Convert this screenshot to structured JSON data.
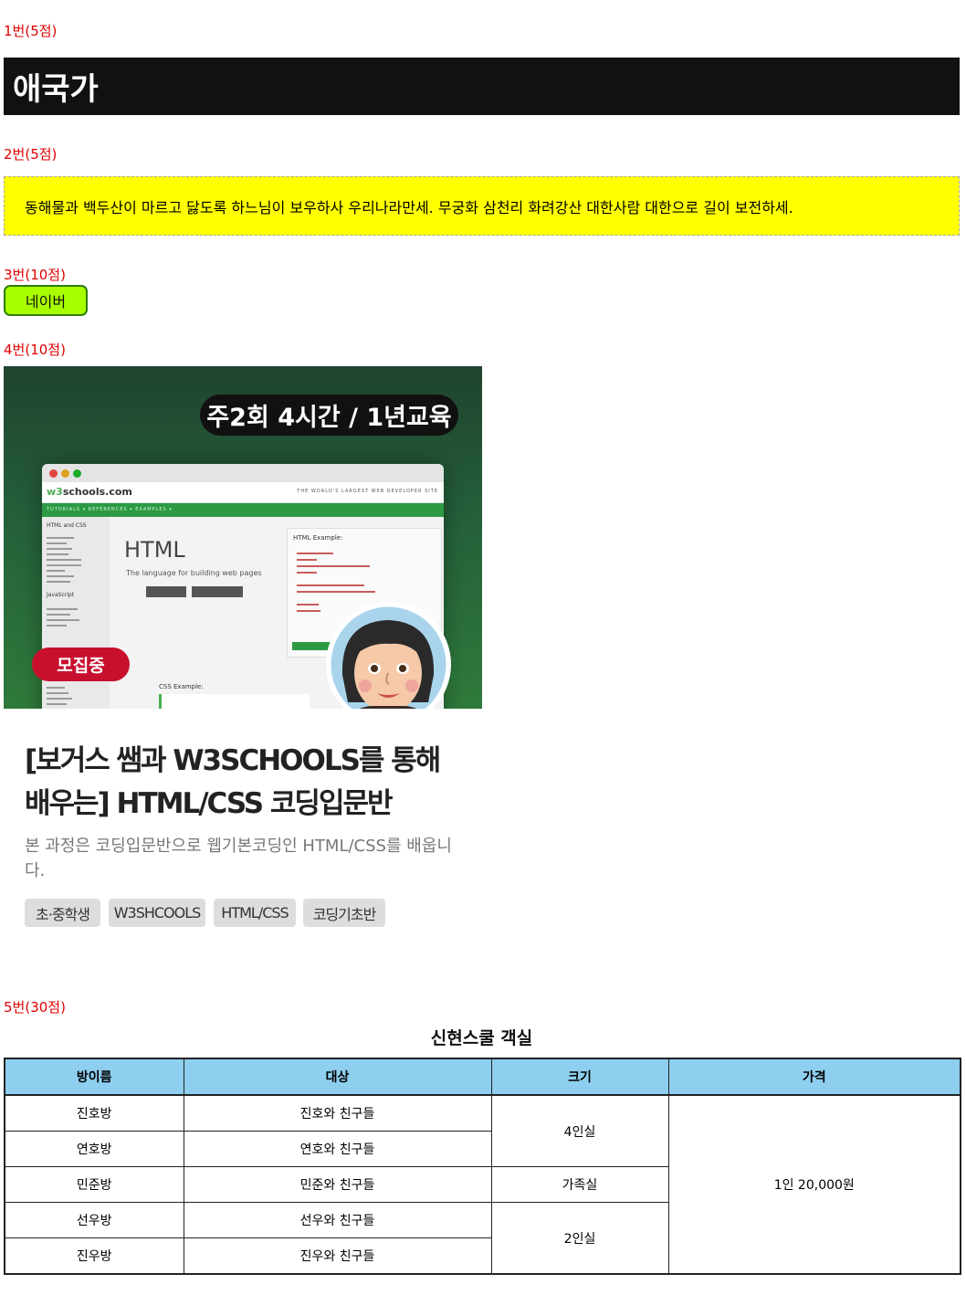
{
  "q1": {
    "label": "1번(5점)",
    "heading": "애국가"
  },
  "q2": {
    "label": "2번(5점)",
    "lyrics": "동해물과 백두산이 마르고 닳도록 하느님이 보우하사 우리나라만세. 무궁화 삼천리 화려강산 대한사람 대한으로 길이 보전하세."
  },
  "q3": {
    "label": "3번(10점)",
    "button": "네이버",
    "colors": {
      "fill": "#a8ff00",
      "border": "#2f7c06"
    }
  },
  "q4": {
    "label": "4번(10점)",
    "schedule_badge": "주2회 4시간 / 1년교육",
    "status_badge": "모집중",
    "screenshot": {
      "logo_prefix": "w3",
      "logo_rest": "schools.com",
      "tagline": "THE WORLD'S LARGEST WEB DEVELOPER SITE",
      "nav": "TUTORIALS ▾   REFERENCES ▾   EXAMPLES ▾",
      "side_heading_1": "HTML and CSS",
      "side_heading_2": "JavaScript",
      "main_title": "HTML",
      "main_sub": "The language for building web pages",
      "example_title": "HTML Example:",
      "css_example": "CSS Example:"
    },
    "title": "[보거스 쌤과 W3SCHOOLS를 통해 배우는] HTML/CSS 코딩입문반",
    "description": "본 과정은 코딩입문반으로 웹기본코딩인 HTML/CSS를 배웁니다.",
    "tags": [
      "초·중학생",
      "W3SHCOOLS",
      "HTML/CSS",
      "코딩기초반"
    ]
  },
  "q5": {
    "label": "5번(30점)",
    "table_title": "신현스쿨 객실",
    "columns": [
      "방이름",
      "대상",
      "크기",
      "가격"
    ],
    "rows": [
      {
        "room": "진호방",
        "target": "진호와 친구들"
      },
      {
        "room": "연호방",
        "target": "연호와 친구들"
      },
      {
        "room": "민준방",
        "target": "민준와 친구들"
      },
      {
        "room": "선우방",
        "target": "선우와 친구들"
      },
      {
        "room": "진우방",
        "target": "진우와 친구들"
      }
    ],
    "sizes": [
      "4인실",
      "가족실",
      "2인실"
    ],
    "price": "1인 20,000원",
    "header_color": "#8ecfef"
  }
}
